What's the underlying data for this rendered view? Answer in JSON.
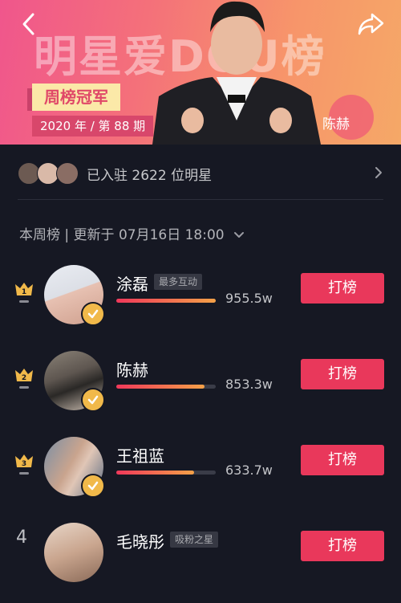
{
  "banner": {
    "big_title": "明星爱DOU榜",
    "ribbon": "周榜冠军",
    "period": "2020 年 / 第 88 期",
    "winner_name": "陈赫",
    "back_icon": "chevron-left-icon",
    "share_icon": "share-icon",
    "gradient": [
      "#f0568c",
      "#f5a867"
    ]
  },
  "joined": {
    "text": "已入驻 2622 位明星",
    "icon": "chevron-right-icon"
  },
  "update": {
    "label": "本周榜",
    "separator": " | ",
    "text": "更新于 07月16日 18:00",
    "icon": "chevron-down-icon"
  },
  "ranking": [
    {
      "rank": "1",
      "name": "涂磊",
      "tag": "最多互动",
      "score": "955.5w",
      "progress": 1.0,
      "vote_label": "打榜"
    },
    {
      "rank": "2",
      "name": "陈赫",
      "tag": "",
      "score": "853.3w",
      "progress": 0.89,
      "vote_label": "打榜"
    },
    {
      "rank": "3",
      "name": "王祖蓝",
      "tag": "",
      "score": "633.7w",
      "progress": 0.78,
      "vote_label": "打榜"
    },
    {
      "rank": "4",
      "name": "毛晓彤",
      "tag": "吸粉之星",
      "score": "",
      "progress": 0,
      "vote_label": "打榜"
    }
  ],
  "colors": {
    "accent": "#e9385b",
    "crown": "#f1b94a",
    "background": "#161823"
  }
}
